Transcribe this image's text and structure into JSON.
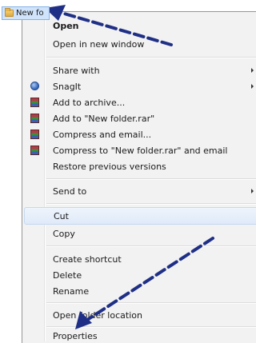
{
  "folder": {
    "name": "New fo",
    "icon": "folder-icon"
  },
  "menu": {
    "items": [
      {
        "label": "Open",
        "bold": true,
        "submenu": false,
        "icon": null
      },
      {
        "label": "Open in new window",
        "bold": false,
        "submenu": false,
        "icon": null
      },
      {
        "label": "Share with",
        "bold": false,
        "submenu": true,
        "icon": null
      },
      {
        "label": "SnagIt",
        "bold": false,
        "submenu": true,
        "icon": "snagit-icon"
      },
      {
        "label": "Add to archive...",
        "bold": false,
        "submenu": false,
        "icon": "winrar-icon"
      },
      {
        "label": "Add to \"New folder.rar\"",
        "bold": false,
        "submenu": false,
        "icon": "winrar-icon"
      },
      {
        "label": "Compress and email...",
        "bold": false,
        "submenu": false,
        "icon": "winrar-icon"
      },
      {
        "label": "Compress to \"New folder.rar\" and email",
        "bold": false,
        "submenu": false,
        "icon": "winrar-icon"
      },
      {
        "label": "Restore previous versions",
        "bold": false,
        "submenu": false,
        "icon": null
      },
      {
        "label": "Send to",
        "bold": false,
        "submenu": true,
        "icon": null
      },
      {
        "label": "Cut",
        "bold": false,
        "submenu": false,
        "icon": null,
        "highlighted": true
      },
      {
        "label": "Copy",
        "bold": false,
        "submenu": false,
        "icon": null
      },
      {
        "label": "Create shortcut",
        "bold": false,
        "submenu": false,
        "icon": null
      },
      {
        "label": "Delete",
        "bold": false,
        "submenu": false,
        "icon": null
      },
      {
        "label": "Rename",
        "bold": false,
        "submenu": false,
        "icon": null
      },
      {
        "label": "Open folder location",
        "bold": false,
        "submenu": false,
        "icon": null
      },
      {
        "label": "Properties",
        "bold": false,
        "submenu": false,
        "icon": null
      }
    ]
  },
  "colors": {
    "menu_background": "#f2f2f2",
    "highlight": "#dfeaf9",
    "annotation_arrow": "#1f2f86"
  }
}
